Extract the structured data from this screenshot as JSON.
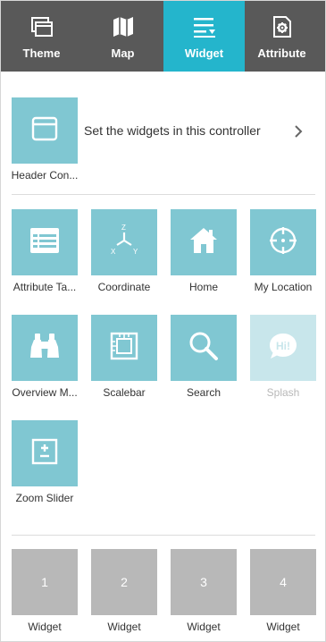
{
  "tabs": [
    {
      "label": "Theme",
      "icon": "theme-icon",
      "active": false
    },
    {
      "label": "Map",
      "icon": "map-icon",
      "active": false
    },
    {
      "label": "Widget",
      "icon": "widget-icon",
      "active": true
    },
    {
      "label": "Attribute",
      "icon": "attribute-icon",
      "active": false
    }
  ],
  "header_controller": {
    "label": "Header Con...",
    "description": "Set the widgets in this controller",
    "icon": "header-controller-icon"
  },
  "widgets": [
    {
      "label": "Attribute Ta...",
      "icon": "attribute-table-icon",
      "enabled": true
    },
    {
      "label": "Coordinate",
      "icon": "coordinate-icon",
      "enabled": true,
      "axis_labels": [
        "Z",
        "X",
        "Y"
      ]
    },
    {
      "label": "Home",
      "icon": "home-icon",
      "enabled": true
    },
    {
      "label": "My Location",
      "icon": "my-location-icon",
      "enabled": true
    },
    {
      "label": "Overview M...",
      "icon": "overview-map-icon",
      "enabled": true
    },
    {
      "label": "Scalebar",
      "icon": "scalebar-icon",
      "enabled": true
    },
    {
      "label": "Search",
      "icon": "search-icon",
      "enabled": true
    },
    {
      "label": "Splash",
      "icon": "splash-icon",
      "enabled": false,
      "icon_text": "Hi!"
    },
    {
      "label": "Zoom Slider",
      "icon": "zoom-slider-icon",
      "enabled": true
    }
  ],
  "slots": [
    {
      "number": "1",
      "label": "Widget"
    },
    {
      "number": "2",
      "label": "Widget"
    },
    {
      "number": "3",
      "label": "Widget"
    },
    {
      "number": "4",
      "label": "Widget"
    }
  ],
  "colors": {
    "tab_bar": "#595959",
    "tab_active": "#24b5cc",
    "tile": "#80c7d2",
    "tile_disabled": "#c8e6eb",
    "slot": "#b8b8b8"
  }
}
